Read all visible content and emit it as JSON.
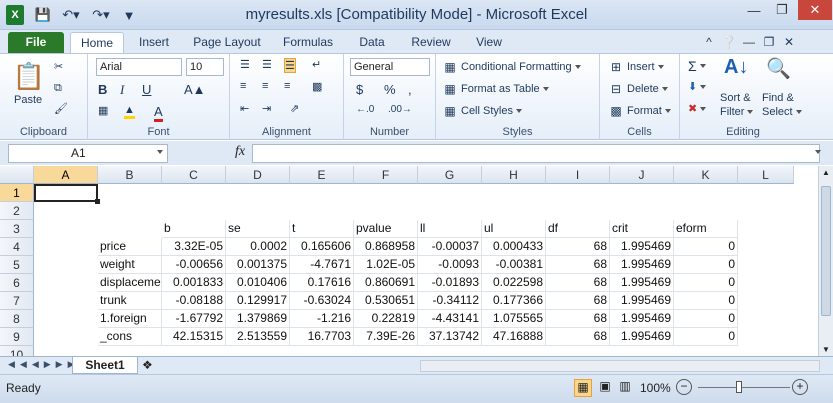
{
  "window": {
    "title": "myresults.xls  [Compatibility Mode]  -  Microsoft Excel"
  },
  "tabs": {
    "file": "File",
    "home": "Home",
    "insert": "Insert",
    "page_layout": "Page Layout",
    "formulas": "Formulas",
    "data": "Data",
    "review": "Review",
    "view": "View"
  },
  "ribbon": {
    "clipboard": {
      "label": "Clipboard",
      "paste": "Paste"
    },
    "font": {
      "label": "Font",
      "name": "Arial",
      "size": "10"
    },
    "alignment": {
      "label": "Alignment"
    },
    "number": {
      "label": "Number",
      "format": "General"
    },
    "styles": {
      "label": "Styles",
      "conditional": "Conditional Formatting",
      "format_table": "Format as Table",
      "cell_styles": "Cell Styles"
    },
    "cells": {
      "label": "Cells",
      "insert": "Insert",
      "delete": "Delete",
      "format": "Format"
    },
    "editing": {
      "label": "Editing",
      "sort": "Sort &",
      "sort2": "Filter",
      "find": "Find &",
      "find2": "Select"
    }
  },
  "formula_bar": {
    "name_box": "A1",
    "fx": "fx",
    "value": ""
  },
  "columns": [
    "A",
    "B",
    "C",
    "D",
    "E",
    "F",
    "G",
    "H",
    "I",
    "J",
    "K",
    "L"
  ],
  "rows": [
    "1",
    "2",
    "3",
    "4",
    "5",
    "6",
    "7",
    "8",
    "9",
    "10"
  ],
  "headers_row3": {
    "C": "b",
    "D": "se",
    "E": "t",
    "F": "pvalue",
    "G": "ll",
    "H": "ul",
    "I": "df",
    "J": "crit",
    "K": "eform"
  },
  "table": [
    {
      "name": "price",
      "b": "3.32E-05",
      "se": "0.0002",
      "t": "0.165606",
      "p": "0.868958",
      "ll": "-0.00037",
      "ul": "0.000433",
      "df": "68",
      "crit": "1.995469",
      "eform": "0"
    },
    {
      "name": "weight",
      "b": "-0.00656",
      "se": "0.001375",
      "t": "-4.7671",
      "p": "1.02E-05",
      "ll": "-0.0093",
      "ul": "-0.00381",
      "df": "68",
      "crit": "1.995469",
      "eform": "0"
    },
    {
      "name": "displaceme",
      "b": "0.001833",
      "se": "0.010406",
      "t": "0.17616",
      "p": "0.860691",
      "ll": "-0.01893",
      "ul": "0.022598",
      "df": "68",
      "crit": "1.995469",
      "eform": "0"
    },
    {
      "name": "trunk",
      "b": "-0.08188",
      "se": "0.129917",
      "t": "-0.63024",
      "p": "0.530651",
      "ll": "-0.34112",
      "ul": "0.177366",
      "df": "68",
      "crit": "1.995469",
      "eform": "0"
    },
    {
      "name": "1.foreign",
      "b": "-1.67792",
      "se": "1.379869",
      "t": "-1.216",
      "p": "0.22819",
      "ll": "-4.43141",
      "ul": "1.075565",
      "df": "68",
      "crit": "1.995469",
      "eform": "0"
    },
    {
      "name": "_cons",
      "b": "42.15315",
      "se": "2.513559",
      "t": "16.7703",
      "p": "7.39E-26",
      "ll": "37.13742",
      "ul": "47.16888",
      "df": "68",
      "crit": "1.995469",
      "eform": "0"
    }
  ],
  "sheet": {
    "tab": "Sheet1"
  },
  "status": {
    "ready": "Ready",
    "zoom": "100%"
  }
}
